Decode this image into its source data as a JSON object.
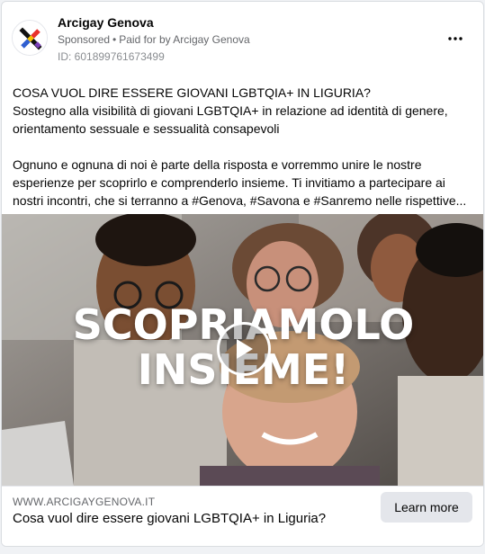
{
  "ad": {
    "page_name": "Arcigay Genova",
    "sponsored": "Sponsored",
    "paid_for": "Paid for by Arcigay Genova",
    "ad_id": "ID: 601899761673499"
  },
  "text": {
    "line1": "COSA VUOL DIRE ESSERE GIOVANI LGBTQIA+ IN LIGURIA?",
    "line2": "Sostegno alla visibilità di giovani LGBTQIA+ in relazione ad identità di genere,",
    "line3": "orientamento sessuale e sessualità consapevoli",
    "line4": "Ognuno e ognuna di noi è parte della risposta e vorremmo unire le nostre",
    "line5": "esperienze per scoprirlo e comprenderlo insieme. Ti invitiamo a partecipare ai",
    "line6": "nostri incontri, che si terranno a #Genova, #Savona e #Sanremo nelle rispettive..."
  },
  "media": {
    "overlay_line1": "SCOPRIAMOLO",
    "overlay_line2": "INSIEME!"
  },
  "footer": {
    "domain": "WWW.ARCIGAYGENOVA.IT",
    "title": "Cosa vuol dire essere giovani LGBTQIA+ in Liguria?",
    "cta": "Learn more"
  },
  "icons": {
    "avatar": "arcigay-logo-icon",
    "more": "more-options-icon",
    "play": "play-icon"
  }
}
